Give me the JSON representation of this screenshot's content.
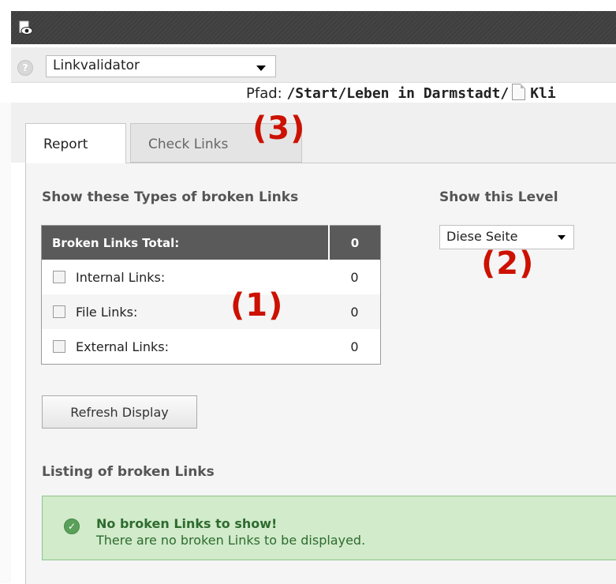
{
  "module_select": {
    "value": "Linkvalidator"
  },
  "path": {
    "label": "Pfad:",
    "value": "/Start/Leben in Darmstadt/",
    "page": "Kli"
  },
  "tabs": [
    {
      "label": "Report"
    },
    {
      "label": "Check Links"
    }
  ],
  "sections": {
    "types_heading": "Show these Types of broken Links",
    "level_heading": "Show this Level",
    "listing_heading": "Listing of broken Links"
  },
  "stats": {
    "total_label": "Broken Links Total:",
    "total_value": "0",
    "rows": [
      {
        "label": "Internal Links:",
        "value": "0",
        "checked": false
      },
      {
        "label": "File Links:",
        "value": "0",
        "checked": false
      },
      {
        "label": "External Links:",
        "value": "0",
        "checked": false
      }
    ]
  },
  "level_select": {
    "value": "Diese Seite"
  },
  "refresh_button": {
    "label": "Refresh Display"
  },
  "message": {
    "title": "No broken Links to show!",
    "body": "There are no broken Links to be displayed."
  },
  "callouts": {
    "one": "(1)",
    "two": "(2)",
    "three": "(3)"
  },
  "colors": {
    "callout": "#cc1100",
    "success_bg": "#d1ebcb",
    "success_text": "#2e6b2e",
    "header_bg": "#5a5a5a"
  },
  "icons": {
    "module": "eye-icon",
    "help": "help-icon",
    "page": "page-icon",
    "success": "check-circle-icon"
  }
}
